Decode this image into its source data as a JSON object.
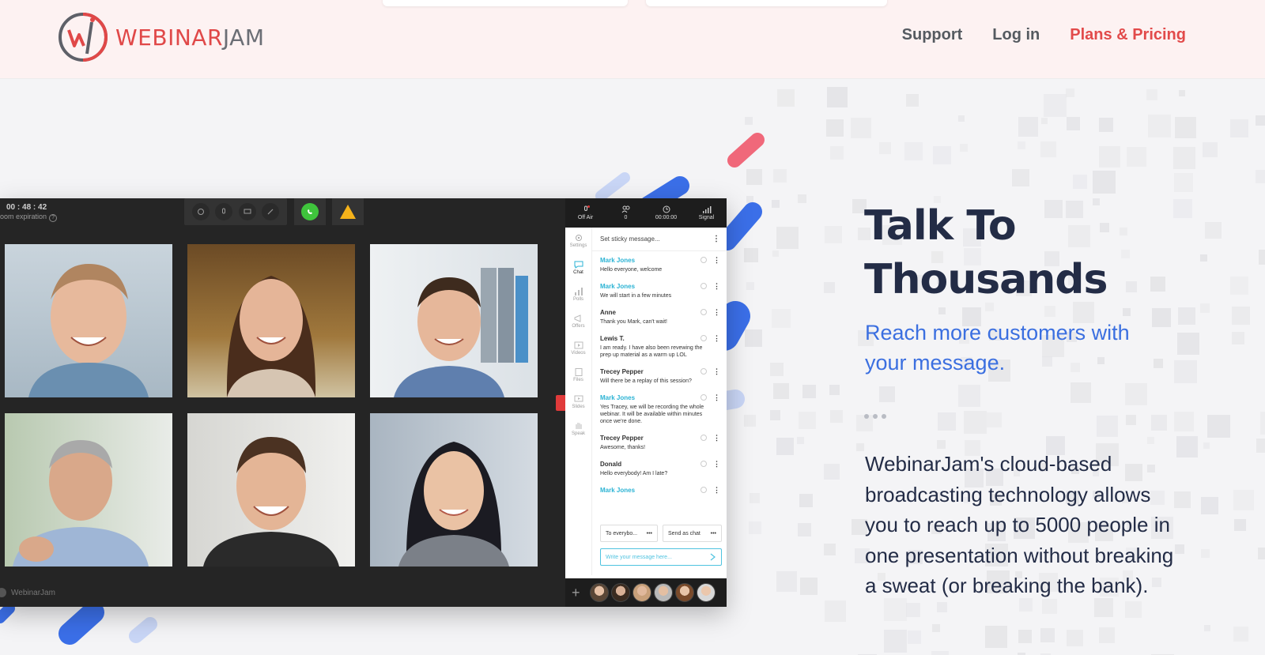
{
  "header": {
    "logo_left": "WEBINAR",
    "logo_right": "JAM",
    "nav": {
      "support": "Support",
      "login": "Log in",
      "pricing": "Plans & Pricing"
    }
  },
  "app": {
    "timer": "00 : 48 : 42",
    "expiry": "oom expiration",
    "status": [
      {
        "label": "Off Air",
        "icon": "mic-icon"
      },
      {
        "label": "0",
        "icon": "attendees-icon"
      },
      {
        "label": "00:00:00",
        "icon": "clock-icon"
      },
      {
        "label": "Signal",
        "icon": "signal-icon"
      }
    ],
    "side_nav": [
      "Settings",
      "Chat",
      "Polls",
      "Offers",
      "Videos",
      "Files",
      "Slides",
      "Speak"
    ],
    "sticky_placeholder": "Set sticky message...",
    "messages": [
      {
        "name": "Mark Jones",
        "text": "Hello everyone, welcome",
        "host": true
      },
      {
        "name": "Mark Jones",
        "text": "We will start in a few minutes",
        "host": true
      },
      {
        "name": "Anne",
        "text": "Thank you Mark, can't wait!",
        "host": false
      },
      {
        "name": "Lewis T.",
        "text": "I am ready. I have also been revewing the prep up material as a warm up LOL",
        "host": false
      },
      {
        "name": "Trecey Pepper",
        "text": "Will there be a replay of this session?",
        "host": false
      },
      {
        "name": "Mark Jones",
        "text": "Yes Tracey, we will be recording the whole webinar. It will be available within minutes once we're done.",
        "host": true
      },
      {
        "name": "Trecey Pepper",
        "text": "Awesome, thanks!",
        "host": false
      },
      {
        "name": "Donald",
        "text": "Hello everybody! Am I late?",
        "host": false
      },
      {
        "name": "Mark Jones",
        "text": "",
        "host": true
      }
    ],
    "to_select": "To everybo...",
    "send_as": "Send as chat",
    "write_placeholder": "Write your message here...",
    "footer_brand": "WebinarJam"
  },
  "hero": {
    "title": "Talk To Thousands",
    "subtitle": "Reach more customers with your message.",
    "body": "WebinarJam's cloud-based broadcasting technology allows you to reach up to 5000 people in one presentation without breaking a sweat (or breaking the bank)."
  }
}
